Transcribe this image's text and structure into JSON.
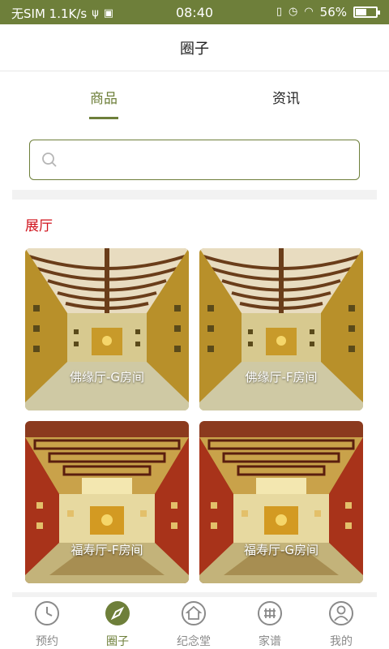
{
  "status": {
    "carrier": "无SIM 1.1K/s",
    "time": "08:40",
    "battery": "56%",
    "battery_level": 0.56
  },
  "header": {
    "title": "圈子"
  },
  "tabs": [
    {
      "label": "商品",
      "active": true
    },
    {
      "label": "资讯",
      "active": false
    }
  ],
  "search": {
    "placeholder": ""
  },
  "section": {
    "title": "展厅"
  },
  "cards": [
    {
      "label": "佛缘厅-G房间"
    },
    {
      "label": "佛缘厅-F房间"
    },
    {
      "label": "福寿厅-F房间"
    },
    {
      "label": "福寿厅-G房间"
    }
  ],
  "tabbar": [
    {
      "label": "预约",
      "icon": "clock-icon"
    },
    {
      "label": "圈子",
      "icon": "compass-icon",
      "active": true
    },
    {
      "label": "纪念堂",
      "icon": "home-icon"
    },
    {
      "label": "家谱",
      "icon": "grid-icon"
    },
    {
      "label": "我的",
      "icon": "user-icon"
    }
  ],
  "colors": {
    "accent": "#6e7f3a",
    "section_title": "#d0121b",
    "inactive": "#8a8a8a"
  }
}
